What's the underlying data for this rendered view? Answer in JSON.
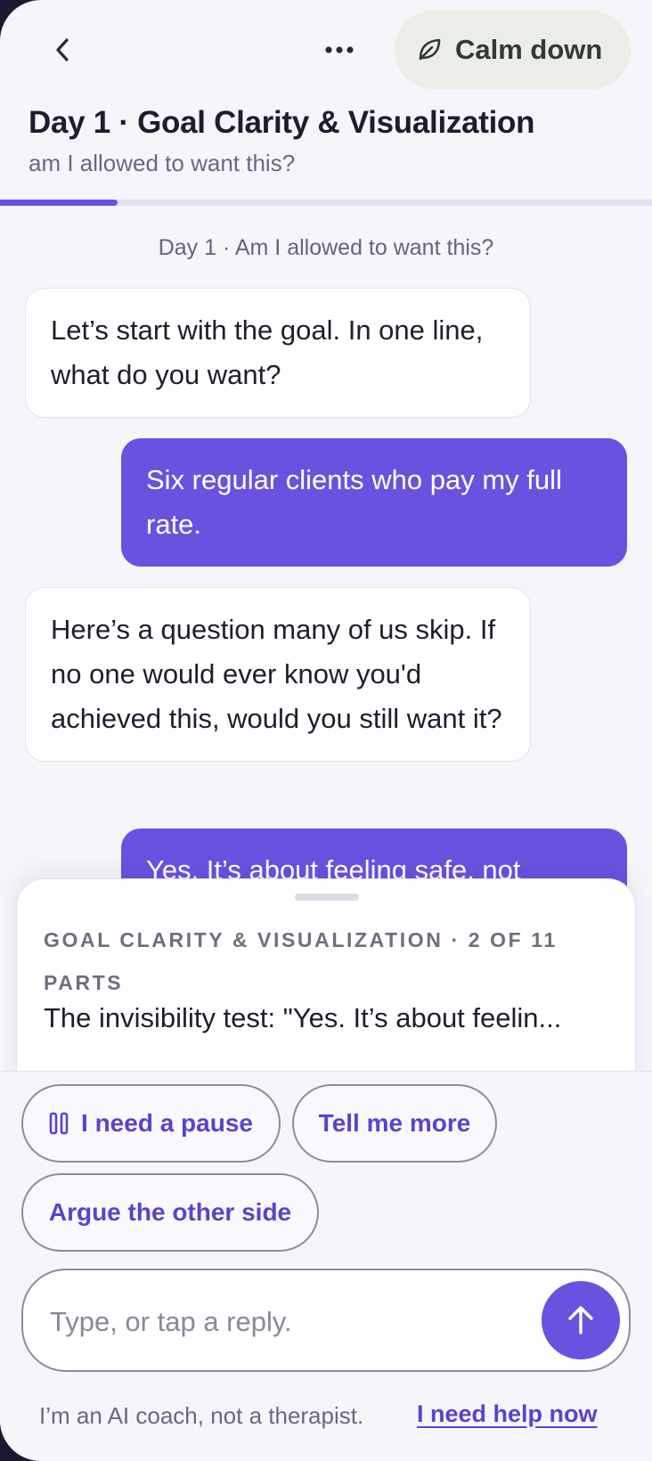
{
  "header": {
    "calm_label": "Calm down",
    "title": "Day 1 · Goal Clarity & Visualization",
    "subtitle": "am I allowed to want this?",
    "progress_fraction": 0.18
  },
  "chat": {
    "day_label": "Day 1 · Am I allowed to want this?",
    "messages": [
      {
        "role": "coach",
        "text": "Let’s start with the goal. In one line, what do you want?"
      },
      {
        "role": "user",
        "text": "Six regular clients who pay my full rate."
      },
      {
        "role": "coach",
        "text": "Here’s a question many of us skip. If no one would ever know you'd achieved this, would you still want it?"
      },
      {
        "role": "user",
        "text": "Yes. It’s about feeling safe, not"
      }
    ]
  },
  "sheet": {
    "heading": "GOAL CLARITY & VISUALIZATION · 2 OF 11 PARTS",
    "preview": "The invisibility test: \"Yes. It’s about feelin..."
  },
  "quick_replies": [
    {
      "label": "I need a pause",
      "icon": "pause-icon"
    },
    {
      "label": "Tell me more"
    },
    {
      "label": "Argue the other side"
    }
  ],
  "composer": {
    "placeholder": "Type, or tap a reply.",
    "value": ""
  },
  "footer": {
    "disclaimer": "I’m an AI coach, not a therapist.",
    "help_link": "I need help now"
  },
  "colors": {
    "accent": "#6a52e0",
    "calm_bg": "#eaeee6",
    "background": "#f6f5fa"
  }
}
